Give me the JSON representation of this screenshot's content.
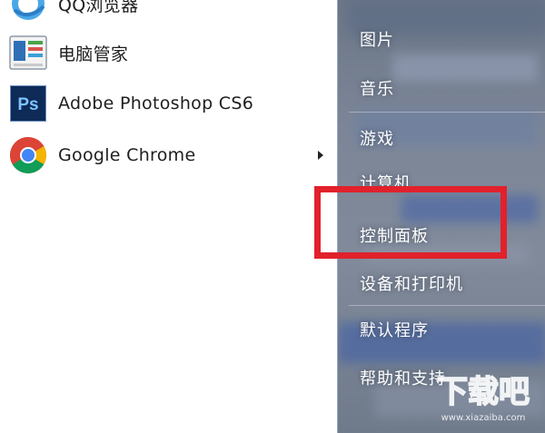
{
  "programs": [
    {
      "label": "QQ浏览器",
      "icon": "qq-browser-icon"
    },
    {
      "label": "电脑管家",
      "icon": "pc-manager-icon"
    },
    {
      "label": "Adobe Photoshop CS6",
      "icon": "photoshop-icon",
      "icon_text": "Ps"
    },
    {
      "label": "Google Chrome",
      "icon": "chrome-icon",
      "has_submenu": true
    }
  ],
  "menu": [
    {
      "label": "图片"
    },
    {
      "label": "音乐"
    },
    {
      "label": "游戏"
    },
    {
      "label": "计算机"
    },
    {
      "label": "控制面板",
      "highlighted": true
    },
    {
      "label": "设备和打印机"
    },
    {
      "label": "默认程序"
    },
    {
      "label": "帮助和支持"
    }
  ],
  "watermark": {
    "text": "下载吧",
    "url_text": "www.xiazaiba.com"
  },
  "colors": {
    "highlight": "#e1212b",
    "photoshop_bg": "#0e2a57",
    "photoshop_text": "#7cc4ff",
    "panel_bg": "#7a8596"
  }
}
